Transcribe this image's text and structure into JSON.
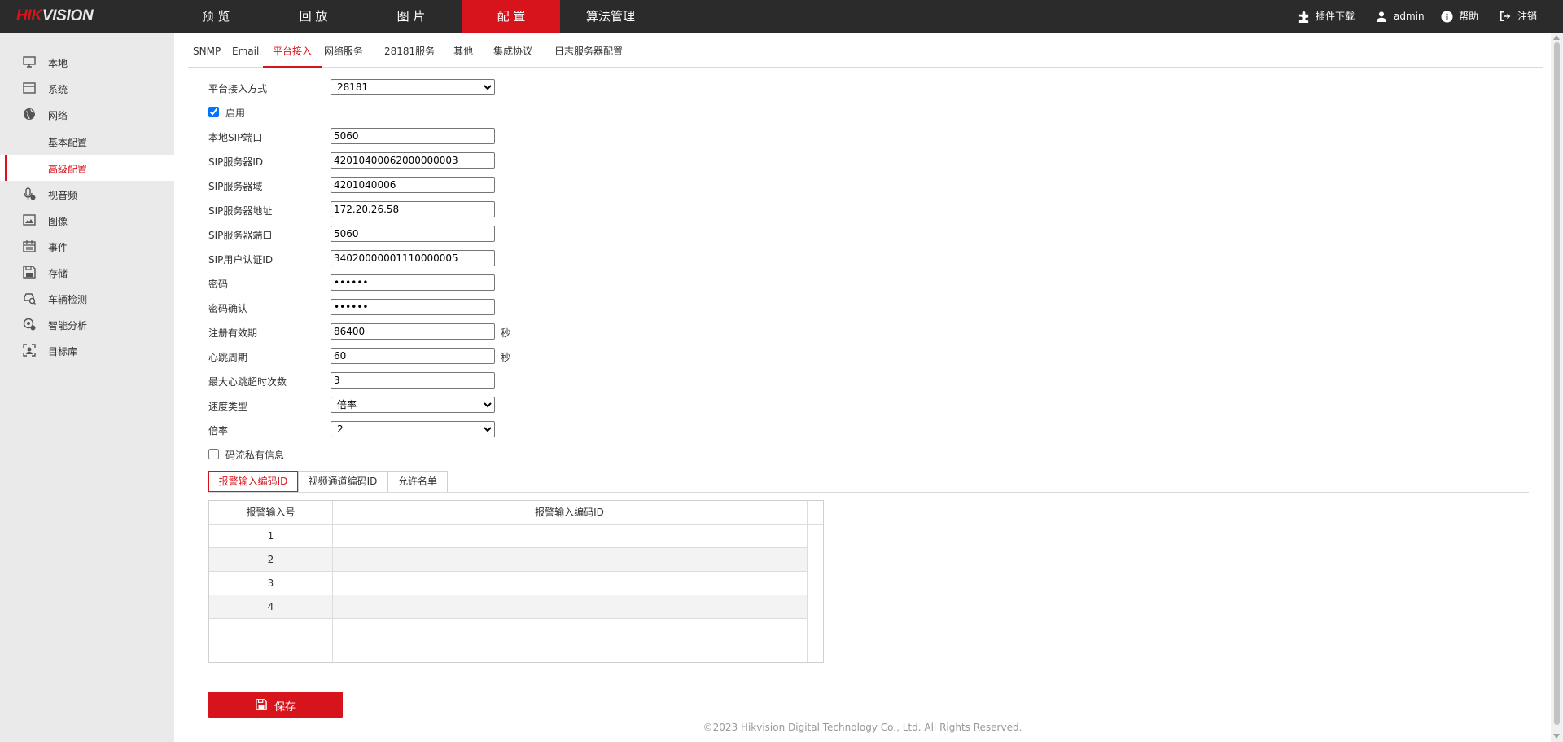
{
  "brand": {
    "logo_red": "HIK",
    "logo_white": "VISION"
  },
  "nav": [
    {
      "label": "预 览"
    },
    {
      "label": "回 放"
    },
    {
      "label": "图 片"
    },
    {
      "label": "配 置"
    },
    {
      "label": "算法管理"
    }
  ],
  "topright": {
    "plugin": "插件下载",
    "user": "admin",
    "help": "帮助",
    "logout": "注销"
  },
  "sidebar": {
    "local": "本地",
    "system": "系统",
    "network": "网络",
    "basic_config": "基本配置",
    "advanced_config": "高级配置",
    "video_audio": "视音频",
    "image": "图像",
    "event": "事件",
    "storage": "存储",
    "vehicle_detection": "车辆检测",
    "smart_analysis": "智能分析",
    "target_library": "目标库"
  },
  "tabs": {
    "snmp": "SNMP",
    "email": "Email",
    "platform": "平台接入",
    "network_service": "网络服务",
    "service_28181": "28181服务",
    "other": "其他",
    "integration": "集成协议",
    "log_server": "日志服务器配置"
  },
  "form": {
    "access_mode_label": "平台接入方式",
    "access_mode_value": "28181",
    "enable_label": "启用",
    "local_sip_port_label": "本地SIP端口",
    "local_sip_port_value": "5060",
    "sip_server_id_label": "SIP服务器ID",
    "sip_server_id_value": "42010400062000000003",
    "sip_server_domain_label": "SIP服务器域",
    "sip_server_domain_value": "4201040006",
    "sip_server_addr_label": "SIP服务器地址",
    "sip_server_addr_value": "172.20.26.58",
    "sip_server_port_label": "SIP服务器端口",
    "sip_server_port_value": "5060",
    "sip_user_auth_label": "SIP用户认证ID",
    "sip_user_auth_value": "34020000001110000005",
    "password_label": "密码",
    "password_value": "••••••",
    "password_confirm_label": "密码确认",
    "password_confirm_value": "••••••",
    "reg_validity_label": "注册有效期",
    "reg_validity_value": "86400",
    "reg_validity_unit": "秒",
    "heartbeat_label": "心跳周期",
    "heartbeat_value": "60",
    "heartbeat_unit": "秒",
    "max_timeout_label": "最大心跳超时次数",
    "max_timeout_value": "3",
    "speed_type_label": "速度类型",
    "speed_type_value": "倍率",
    "rate_label": "倍率",
    "rate_value": "2",
    "private_info_label": "码流私有信息"
  },
  "subtabs": {
    "alarm_input": "报警输入编码ID",
    "video_channel": "视频通道编码ID",
    "allow_list": "允许名单"
  },
  "table": {
    "headers": [
      "报警输入号",
      "报警输入编码ID"
    ],
    "rows": [
      {
        "no": "1",
        "id": ""
      },
      {
        "no": "2",
        "id": ""
      },
      {
        "no": "3",
        "id": ""
      },
      {
        "no": "4",
        "id": ""
      }
    ]
  },
  "save_label": "保存",
  "footer": "©2023 Hikvision Digital Technology Co., Ltd. All Rights Reserved.",
  "colors": {
    "accent": "#d7141b",
    "topbar": "#2b2b2b",
    "sidebar": "#eaeaea"
  }
}
